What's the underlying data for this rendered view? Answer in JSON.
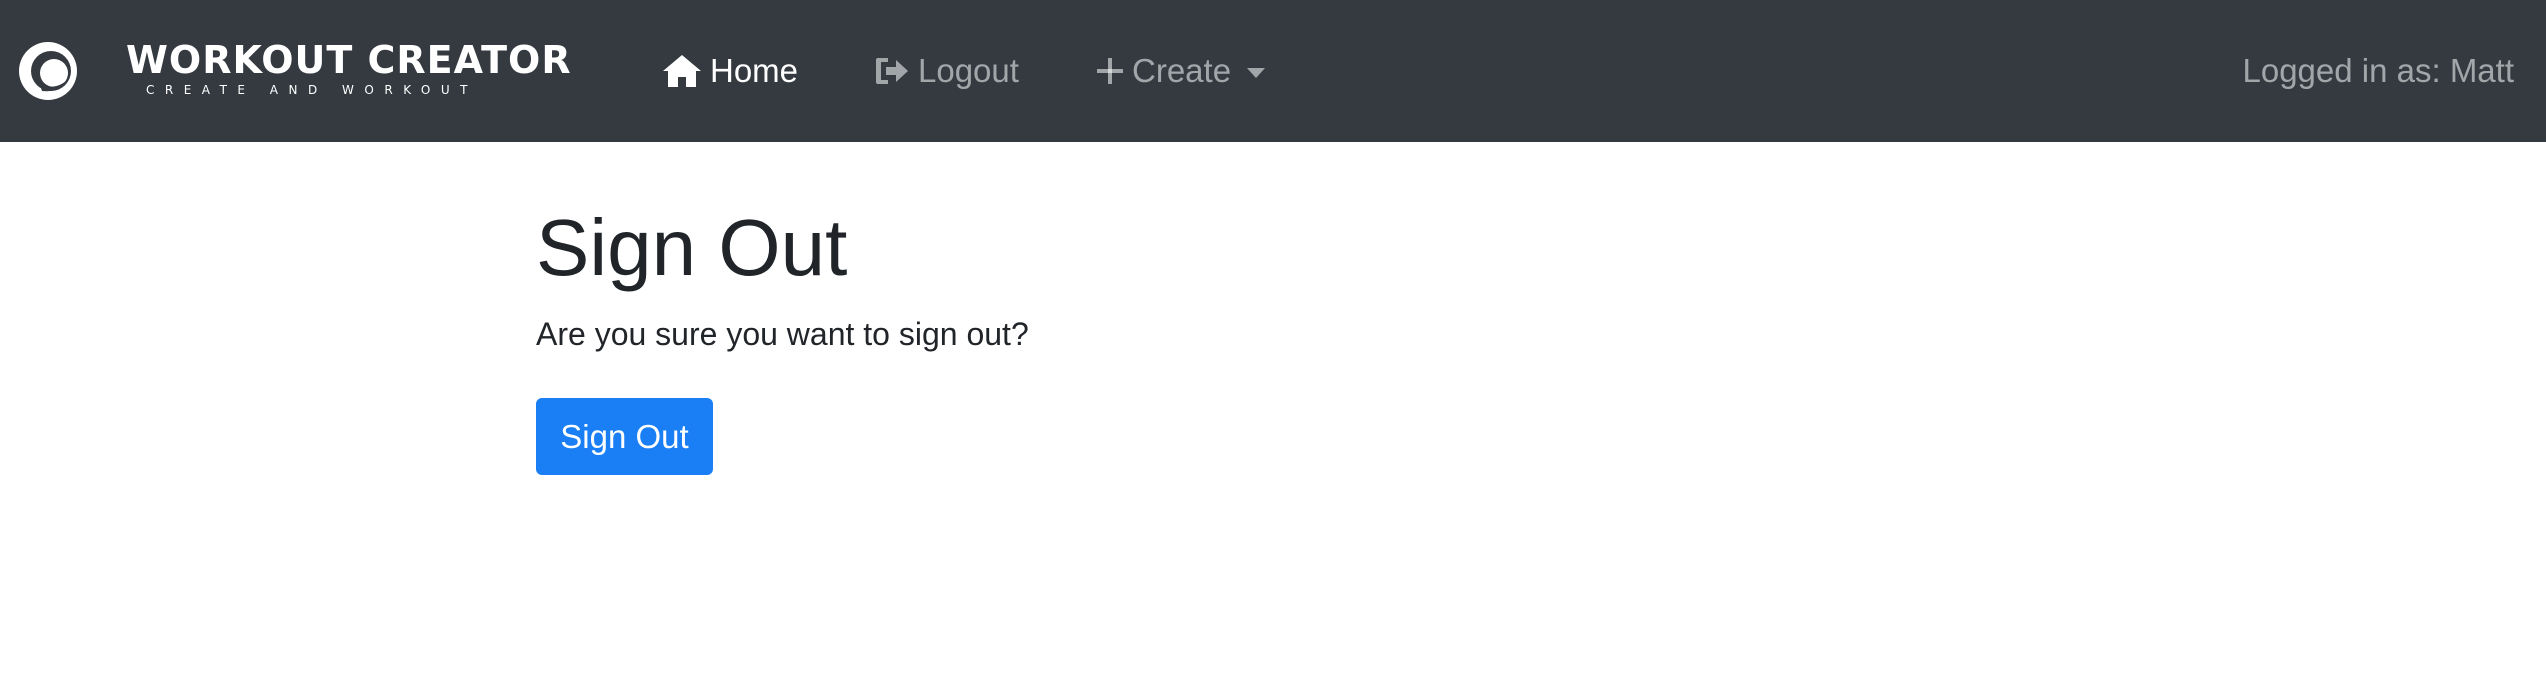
{
  "brand": {
    "title": "WORKOUT CREATOR",
    "subtitle": "CREATE AND WORKOUT",
    "logo_icon": "swirl-logo-icon"
  },
  "nav": {
    "items": [
      {
        "label": "Home",
        "icon": "home-icon",
        "active": true
      },
      {
        "label": "Logout",
        "icon": "sign-out-icon",
        "active": false
      },
      {
        "label": "Create",
        "icon": "plus-icon",
        "active": false,
        "dropdown": true
      }
    ],
    "user_text": "Logged in as: Matt"
  },
  "main": {
    "title": "Sign Out",
    "message": "Are you sure you want to sign out?",
    "button_label": "Sign Out"
  },
  "colors": {
    "navbar_bg": "#343a40",
    "primary": "#1a7ff5",
    "nav_muted": "rgba(255,255,255,0.55)",
    "text": "#212529"
  }
}
